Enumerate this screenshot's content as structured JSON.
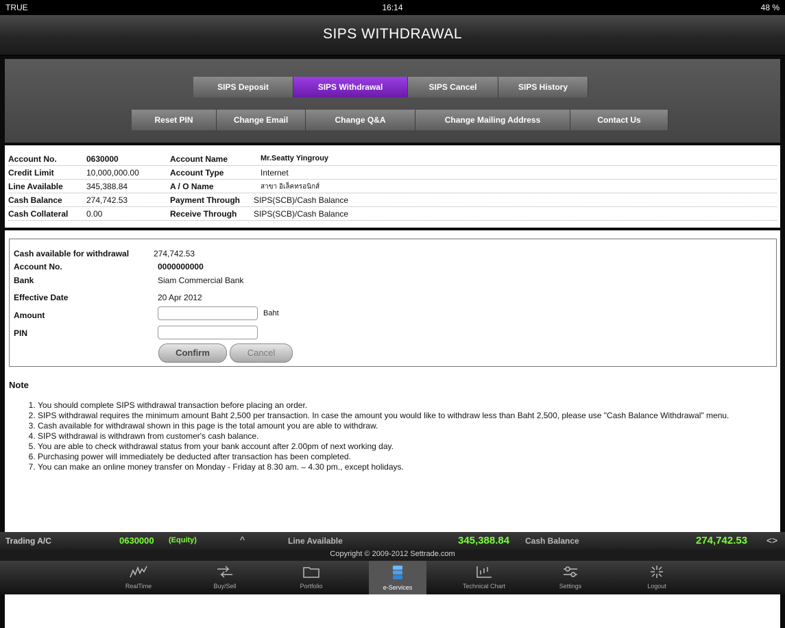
{
  "status_bar": {
    "carrier": "TRUE",
    "time": "16:14",
    "battery": "48 %"
  },
  "header": {
    "title": "SIPS WITHDRAWAL"
  },
  "tabs_row1": [
    {
      "label": "SIPS Deposit"
    },
    {
      "label": "SIPS Withdrawal",
      "active": true
    },
    {
      "label": "SIPS Cancel"
    },
    {
      "label": "SIPS History"
    }
  ],
  "tabs_row2": [
    {
      "label": "Reset PIN"
    },
    {
      "label": "Change Email"
    },
    {
      "label": "Change Q&A"
    },
    {
      "label": "Change Mailing Address"
    },
    {
      "label": "Contact Us"
    }
  ],
  "account_info": {
    "account_no_label": "Account No.",
    "account_no": "0630000",
    "account_name_label": "Account Name",
    "account_name": "Mr.Seatty Yingrouy",
    "credit_limit_label": "Credit Limit",
    "credit_limit": "10,000,000.00",
    "account_type_label": "Account Type",
    "account_type": "Internet",
    "line_available_label": "Line Available",
    "line_available": "345,388.84",
    "ao_name_label": "A / O Name",
    "ao_name": "สาขา อิเล็คทรอนิกส์",
    "cash_balance_label": "Cash Balance",
    "cash_balance": "274,742.53",
    "payment_through_label": "Payment Through",
    "payment_through": "SIPS(SCB)/Cash Balance",
    "cash_collateral_label": "Cash Collateral",
    "cash_collateral": "0.00",
    "receive_through_label": "Receive Through",
    "receive_through": "SIPS(SCB)/Cash Balance"
  },
  "withdrawal_form": {
    "cash_available_label": "Cash available for withdrawal",
    "cash_available": "274,742.53",
    "account_no_label": "Account No.",
    "account_no": "0000000000",
    "bank_label": "Bank",
    "bank": "Siam Commercial Bank",
    "effective_date_label": "Effective Date",
    "effective_date": "20 Apr 2012",
    "amount_label": "Amount",
    "amount_value": "",
    "amount_unit": "Baht",
    "pin_label": "PIN",
    "pin_value": "",
    "confirm_label": "Confirm",
    "cancel_label": "Cancel"
  },
  "note": {
    "title": "Note",
    "items": [
      "You should complete SIPS withdrawal transaction before placing an order.",
      "SIPS withdrawal requires the minimum amount Baht 2,500 per transaction. In case the amount you would like to withdraw less than Baht 2,500, please use \"Cash Balance Withdrawal\" menu.",
      "Cash available for withdrawal shown in this page is the total amount you are able to withdraw.",
      "SIPS withdrawal is withdrawn from customer's cash balance.",
      "You are able to check withdrawal status from your bank account after 2.00pm of next working day.",
      "Purchasing power will immediately be deducted after transaction has been completed.",
      "You can make an online money transfer on Monday - Friday at 8.30 am. – 4.30 pm., except holidays."
    ]
  },
  "bottom_bar": {
    "trading_label": "Trading A/C",
    "trading_account": "0630000",
    "account_type": "(Equity)",
    "line_available_label": "Line Available",
    "line_available": "345,388.84",
    "cash_balance_label": "Cash Balance",
    "cash_balance": "274,742.53"
  },
  "copyright": "Copyright © 2009-2012 Settrade.com",
  "toolbar": [
    {
      "label": "RealTime",
      "icon": "realtime-chart-icon"
    },
    {
      "label": "Buy/Sell",
      "icon": "buy-sell-arrows-icon"
    },
    {
      "label": "Portfolio",
      "icon": "folder-icon"
    },
    {
      "label": "e-Services",
      "icon": "server-icon",
      "active": true
    },
    {
      "label": "Technical Chart",
      "icon": "technical-chart-icon"
    },
    {
      "label": "Settings",
      "icon": "settings-icon"
    },
    {
      "label": "Logout",
      "icon": "logout-icon"
    }
  ]
}
